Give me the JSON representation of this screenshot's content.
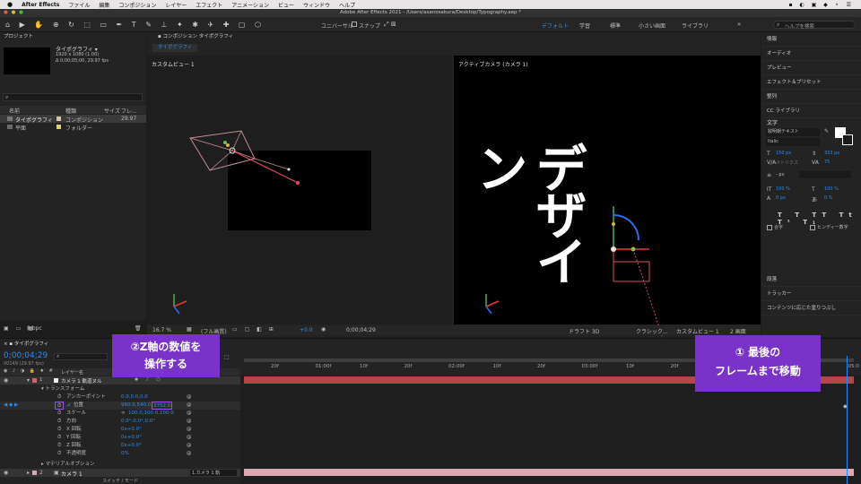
{
  "menubar": {
    "apple_icon": "apple-icon",
    "app_name": "After Effects",
    "items": [
      "ファイル",
      "編集",
      "コンポジション",
      "レイヤー",
      "エフェクト",
      "アニメーション",
      "ビュー",
      "ウィンドウ",
      "ヘルプ"
    ]
  },
  "window": {
    "title": "Adobe After Effects 2021 - /Users/asanosakura/Desktop/Typography.aep *"
  },
  "toolbar": {
    "universal_label": "ユニバーサル",
    "snap_label": "スナップ",
    "workspaces": [
      "デフォルト",
      "学習",
      "標準",
      "小さい画面",
      "ライブラリ"
    ],
    "help_search_placeholder": "ヘルプを検索"
  },
  "project": {
    "panel_title": "プロジェクト",
    "comp_name": "タイポグラフィ ▾",
    "comp_size": "1920 x 1080 (1.00)",
    "comp_duration": "Δ 0;00;05;00, 29.97 fps",
    "columns": [
      "名前",
      "種類",
      "サイズ",
      "フレ..."
    ],
    "items": [
      {
        "name": "タイポグラフィ",
        "type": "コンポジション",
        "fps": "29.97"
      },
      {
        "name": "平面",
        "type": "フォルダー",
        "fps": ""
      }
    ],
    "bpc": "8 bpc"
  },
  "composition": {
    "panel_title": "コンポジション タイポグラフィ",
    "tab": "タイポグラフィ",
    "left_view_label": "カスタムビュー 1",
    "right_view_label": "アクティブカメラ (カメラ 1)",
    "rendered_text": "デザイン",
    "bottom_bar": {
      "zoom": "16.7 %",
      "resolution": "(フル画質)",
      "exposure": "+0.0",
      "timecode": "0;00;04;29",
      "draft3d": "ドラフト 3D",
      "renderer": "クラシック...",
      "view": "カスタムビュー 1",
      "layout": "2 画面"
    }
  },
  "right_panel": {
    "items": [
      "情報",
      "オーディオ",
      "プレビュー",
      "エフェクト＆プリセット",
      "整列",
      "CC ライブラリ"
    ],
    "character": {
      "title": "文字",
      "font": "駿明朝テキスト",
      "style": "Italic",
      "size": "150 px",
      "leading": "333 px",
      "kerning": "メトリクス",
      "tracking": "75",
      "stroke_unit": "- px",
      "vscale": "100 %",
      "hscale": "100 %",
      "baseline": "0 px",
      "tsume": "0 %",
      "ligature_label": "合字",
      "hindi_label": "ヒンディー数字"
    },
    "bottom_items": [
      "段落",
      "トラッカー",
      "コンテンツに応じた塗りつぶし"
    ]
  },
  "timeline": {
    "comp_tab": "タイポグラフィ",
    "timecode": "0;00;04;29",
    "frame_info": "00149 (29.97 fps)",
    "column_header": "レイヤー名",
    "layer": {
      "number": "1",
      "name": "カメラ 1 軌道ヌル"
    },
    "properties": [
      {
        "label": "トランスフォーム",
        "value": ""
      },
      {
        "label": "アンカーポイント",
        "value": "0.0,0.0,0.0"
      },
      {
        "label": "位置",
        "value": "960.0,540.0,",
        "value_z": "3752.0"
      },
      {
        "label": "スケール",
        "value": "100.0,100.0,100.0"
      },
      {
        "label": "方向",
        "value": "0.0°,0.0°,0.0°"
      },
      {
        "label": "X 回転",
        "value": "0x+0.0°"
      },
      {
        "label": "Y 回転",
        "value": "0x+0.0°"
      },
      {
        "label": "Z 回転",
        "value": "0x+0.0°"
      },
      {
        "label": "不透明度",
        "value": "0%"
      }
    ],
    "material_options": "マテリアルオプション",
    "layer2": {
      "number": "2",
      "name": "カメラ 1",
      "parent": "1.カメラ 1 軌"
    },
    "switch_mode": "スイッチ / モード",
    "ruler_ticks": [
      "20f",
      "01:00f",
      "10f",
      "20f",
      "02:00f",
      "10f",
      "20f",
      "03:00f",
      "10f",
      "20f",
      "04:00f",
      "10f",
      "20f",
      "05:0"
    ]
  },
  "annotations": {
    "callout_z_line1": "②Z軸の数値を",
    "callout_z_line2": "操作する",
    "callout_last_line1": "① 最後の",
    "callout_last_line2": "フレームまで移動"
  },
  "colors": {
    "accent_blue": "#2d8ceb",
    "highlight_purple": "#7a33c9",
    "layer_red": "#b4454a",
    "layer_pink": "#d9aab1"
  }
}
